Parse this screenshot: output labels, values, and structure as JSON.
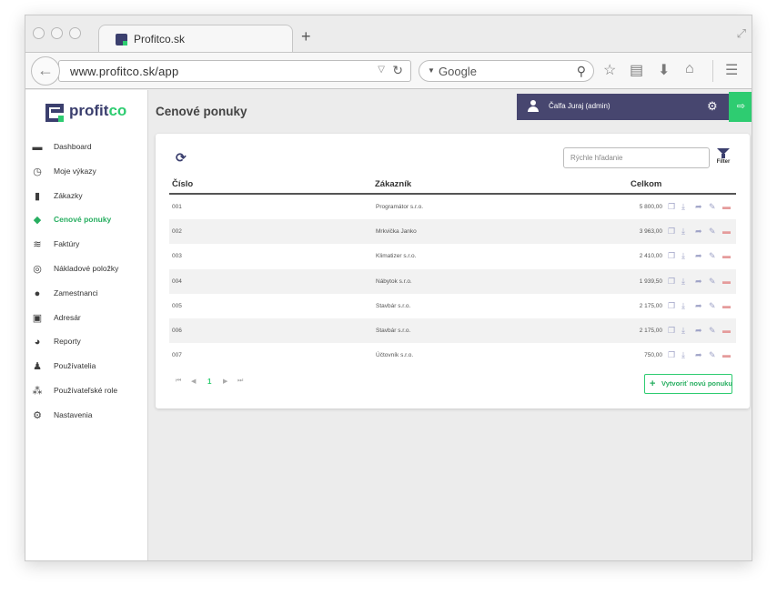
{
  "browser": {
    "tab_title": "Profitco.sk",
    "new_tab": "+",
    "url": "www.profitco.sk/app",
    "search_placeholder": "Google"
  },
  "brand": {
    "name_part1": "profit",
    "name_part2": "co",
    "color_primary": "#3b3f6e",
    "color_accent": "#2ecc71"
  },
  "sidebar": {
    "items": [
      {
        "label": "Dashboard",
        "icon": "dashboard-icon",
        "active": false
      },
      {
        "label": "Moje výkazy",
        "icon": "clock-icon",
        "active": false
      },
      {
        "label": "Zákazky",
        "icon": "document-icon",
        "active": false
      },
      {
        "label": "Cenové ponuky",
        "icon": "tags-icon",
        "active": true
      },
      {
        "label": "Faktúry",
        "icon": "layers-icon",
        "active": false
      },
      {
        "label": "Nákladové položky",
        "icon": "coins-icon",
        "active": false
      },
      {
        "label": "Zamestnanci",
        "icon": "users-icon",
        "active": false
      },
      {
        "label": "Adresár",
        "icon": "address-book-icon",
        "active": false
      },
      {
        "label": "Reporty",
        "icon": "pie-chart-icon",
        "active": false
      },
      {
        "label": "Používatelia",
        "icon": "user-gear-icon",
        "active": false
      },
      {
        "label": "Používateľské role",
        "icon": "users-gear-icon",
        "active": false
      },
      {
        "label": "Nastavenia",
        "icon": "gears-icon",
        "active": false
      }
    ]
  },
  "header": {
    "page_title": "Cenové ponuky",
    "user_name": "Čalfa Juraj (admin)"
  },
  "toolbar": {
    "search_placeholder": "Rýchle hľadanie",
    "filter_label": "Filter"
  },
  "table": {
    "headers": [
      "Číslo",
      "Zákazník",
      "Celkom"
    ],
    "rows": [
      {
        "cislo": "001",
        "zakaznik": "Programátor s.r.o.",
        "celkom": "5 800,00"
      },
      {
        "cislo": "002",
        "zakaznik": "Mrkvička Janko",
        "celkom": "3 963,00"
      },
      {
        "cislo": "003",
        "zakaznik": "Klimatizer s.r.o.",
        "celkom": "2 410,00"
      },
      {
        "cislo": "004",
        "zakaznik": "Nábytok s.r.o.",
        "celkom": "1 939,50"
      },
      {
        "cislo": "005",
        "zakaznik": "Stavbár s.r.o.",
        "celkom": "2 175,00"
      },
      {
        "cislo": "006",
        "zakaznik": "Stavbár s.r.o.",
        "celkom": "2 175,00"
      },
      {
        "cislo": "007",
        "zakaznik": "Účtovník s.r.o.",
        "celkom": "750,00"
      }
    ],
    "row_actions": [
      "copy-icon",
      "download-icon",
      "share-icon",
      "edit-icon",
      "trash-icon"
    ]
  },
  "pagination": {
    "current_page": "1",
    "first": "⏮",
    "prev": "◀",
    "next": "▶",
    "last": "⏭"
  },
  "actions": {
    "create_label": "Vytvoriť novú ponuku"
  }
}
